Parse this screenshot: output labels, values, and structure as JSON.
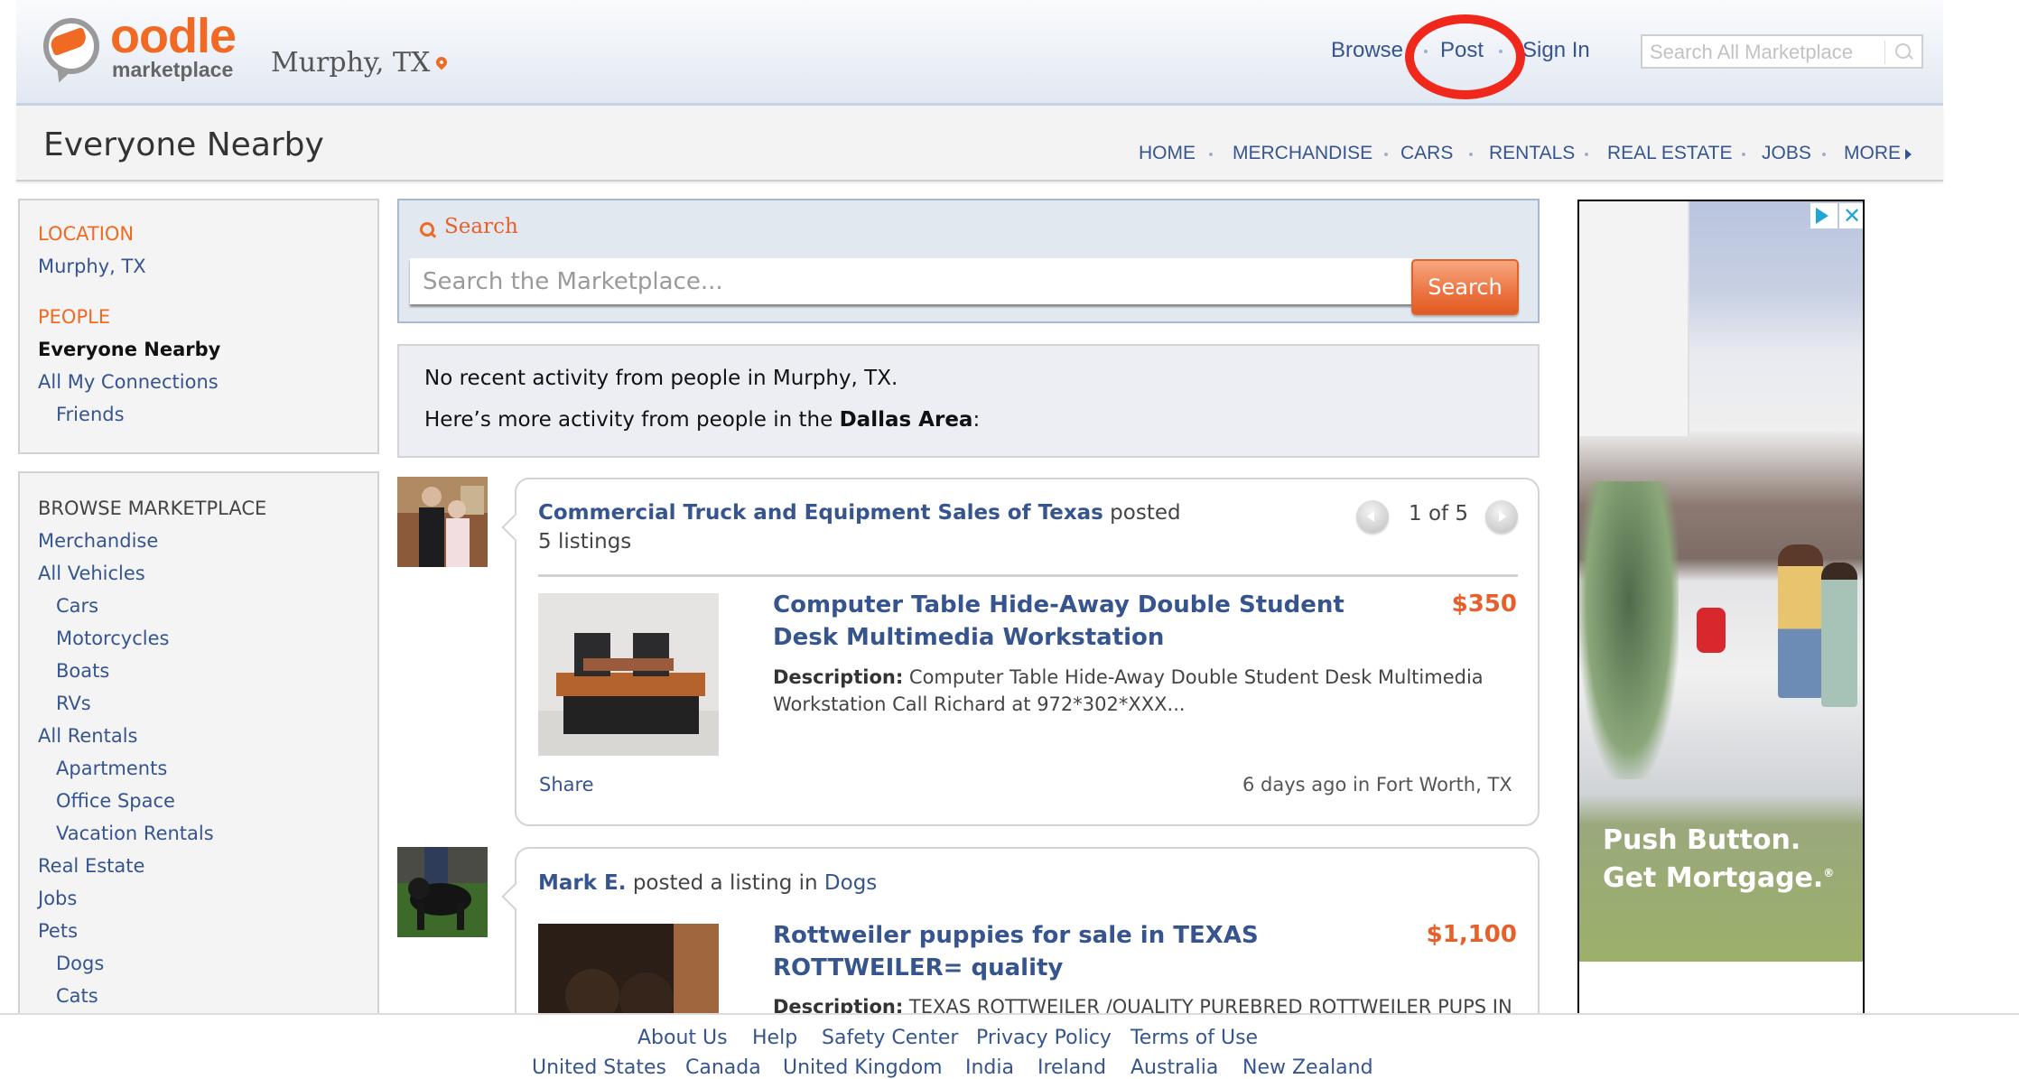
{
  "header": {
    "logo_word": "oodle",
    "logo_sub": "marketplace",
    "location": "Murphy, TX",
    "nav": [
      {
        "label": "Browse"
      },
      {
        "label": "Post"
      },
      {
        "label": "Sign In"
      }
    ],
    "search_placeholder": "Search All Marketplace"
  },
  "subbar": {
    "title": "Everyone Nearby",
    "nav": [
      "HOME",
      "MERCHANDISE",
      "CARS",
      "RENTALS",
      "REAL ESTATE",
      "JOBS",
      "MORE"
    ]
  },
  "sidebar": {
    "location_heading": "LOCATION",
    "location_value": "Murphy, TX",
    "people_heading": "PEOPLE",
    "people_items": [
      {
        "label": "Everyone Nearby",
        "active": true
      },
      {
        "label": "All My Connections"
      },
      {
        "label": "Friends",
        "indent": true
      }
    ],
    "browse_heading": "BROWSE MARKETPLACE",
    "browse_items": [
      {
        "label": "Merchandise"
      },
      {
        "label": "All Vehicles"
      },
      {
        "label": "Cars",
        "indent": true
      },
      {
        "label": "Motorcycles",
        "indent": true
      },
      {
        "label": "Boats",
        "indent": true
      },
      {
        "label": "RVs",
        "indent": true
      },
      {
        "label": "All Rentals"
      },
      {
        "label": "Apartments",
        "indent": true
      },
      {
        "label": "Office Space",
        "indent": true
      },
      {
        "label": "Vacation Rentals",
        "indent": true
      },
      {
        "label": "Real Estate"
      },
      {
        "label": "Jobs"
      },
      {
        "label": "Pets"
      },
      {
        "label": "Dogs",
        "indent": true
      },
      {
        "label": "Cats",
        "indent": true
      }
    ]
  },
  "search": {
    "label": "Search",
    "placeholder": "Search the Marketplace...",
    "button": "Search"
  },
  "info": {
    "line1": "No recent activity from people in Murphy, TX.",
    "line2_prefix": "Here’s more activity from people in the ",
    "line2_bold": "Dallas Area",
    "line2_suffix": ":"
  },
  "feed": [
    {
      "poster": "Commercial Truck and Equipment Sales of Texas",
      "action": " posted",
      "count_text": "5 listings",
      "pager": "1 of 5",
      "listing_title": "Computer Table Hide-Away Double Student Desk Multimedia Workstation",
      "price": "$350",
      "desc_label": "Description:",
      "desc_text": " Computer Table Hide-Away Double Student Desk Multimedia Workstation Call Richard at 972*302*XXX...",
      "share": "Share",
      "meta": "6 days ago in Fort Worth, TX"
    },
    {
      "poster": "Mark E.",
      "action": " posted a listing in ",
      "category": "Dogs",
      "listing_title": "Rottweiler puppies for sale in TEXAS ROTTWEILER= quality",
      "price": "$1,100",
      "desc_label": "Description:",
      "desc_text": " TEXAS ROTTWEILER /QUALITY PUREBRED ROTTWEILER PUPS IN"
    }
  ],
  "ad": {
    "headline_line1": "Push Button.",
    "headline_line2": "Get Mortgage.",
    "registered": "®",
    "close": "✕"
  },
  "footer": {
    "row1": [
      "About Us",
      "Help",
      "Safety Center",
      "Privacy Policy",
      "Terms of Use"
    ],
    "row2": [
      "United States",
      "Canada",
      "United Kingdom",
      "India",
      "Ireland",
      "Australia",
      "New Zealand"
    ]
  },
  "colors": {
    "brand_orange": "#f06a24",
    "link_blue": "#36558f",
    "price_orange": "#e5602a",
    "annotation_red": "#f0281c"
  }
}
